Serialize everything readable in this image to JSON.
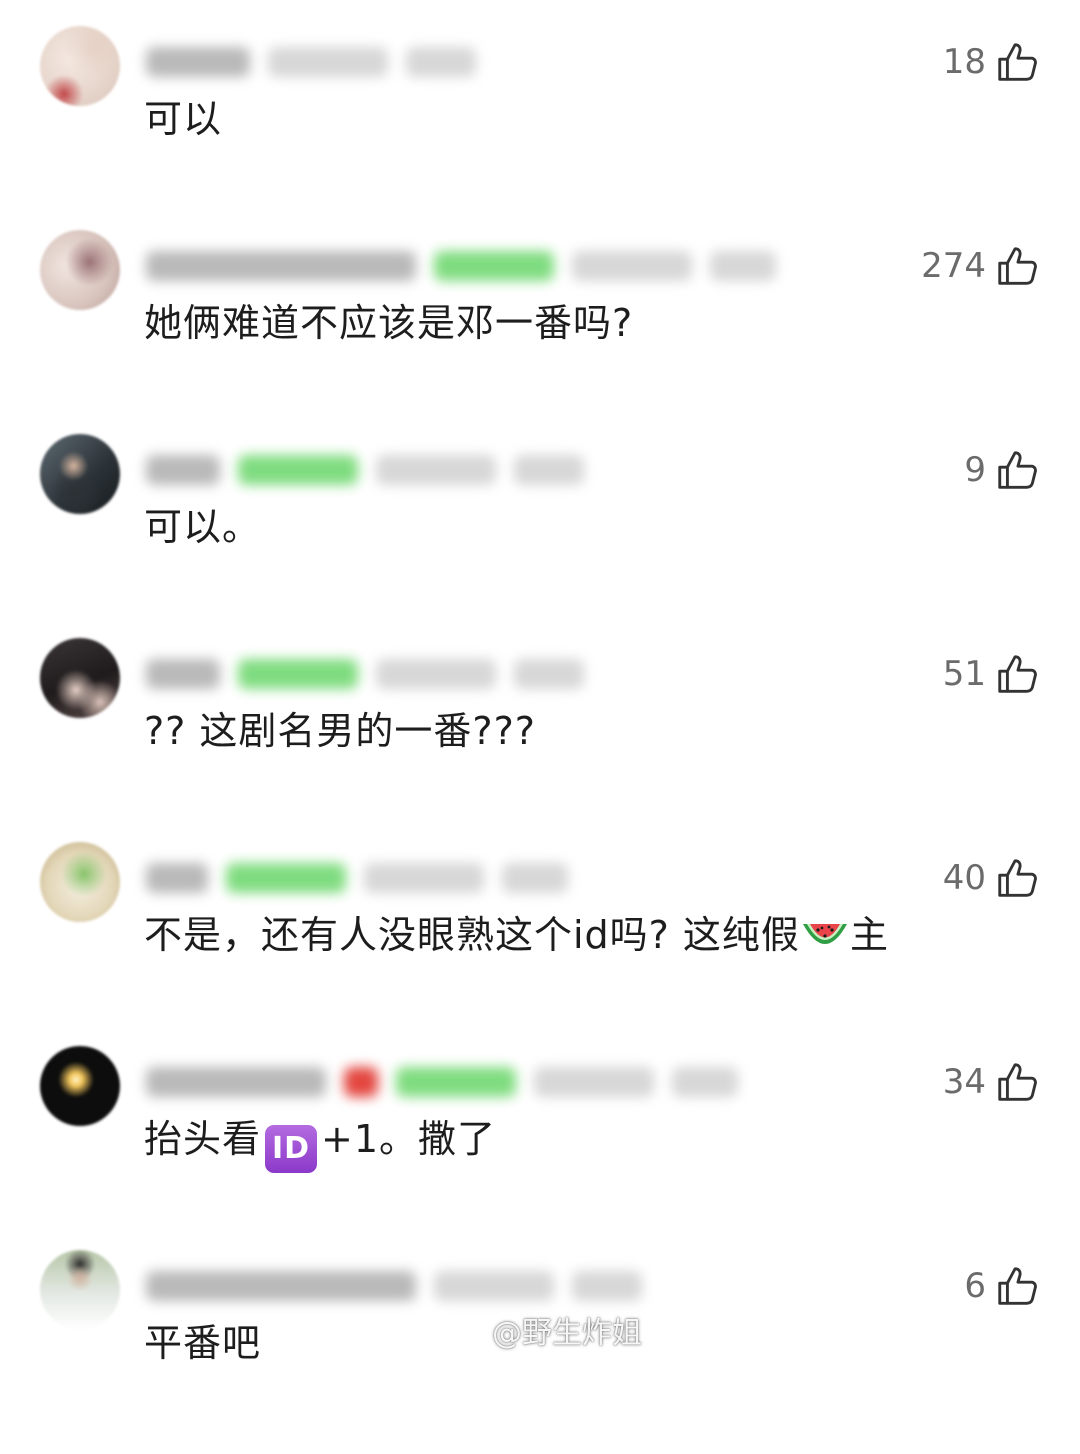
{
  "comments": [
    {
      "text": "可以",
      "likes": "18"
    },
    {
      "text": "她俩难道不应该是邓一番吗?",
      "likes": "274"
    },
    {
      "text": "可以。",
      "likes": "9"
    },
    {
      "text": "?? 这剧名男的一番???",
      "likes": "51"
    },
    {
      "text_before": "不是，还有人没眼熟这个id吗? 这纯假",
      "text_after": "主",
      "emoji_icon": "watermelon-icon",
      "likes": "40"
    },
    {
      "text_before": "抬头看",
      "badge": "ID",
      "text_after": "+1。撒了",
      "likes": "34"
    },
    {
      "text": "平番吧",
      "likes": "6"
    }
  ],
  "icons": {
    "like": "thumbs-up-icon",
    "watermark": "weibo-icon"
  },
  "watermark": {
    "text": "@野生炸姐"
  }
}
